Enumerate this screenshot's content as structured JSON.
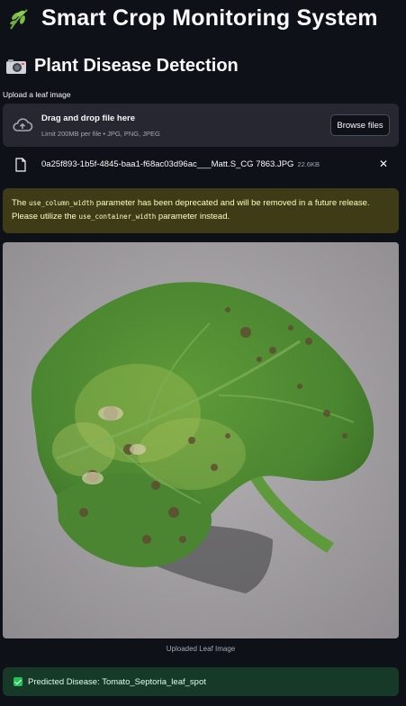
{
  "header": {
    "title": "Smart Crop Monitoring System",
    "title_icon": "seedling-icon"
  },
  "section": {
    "heading": "Plant Disease Detection",
    "heading_icon": "camera-icon"
  },
  "uploader": {
    "label": "Upload a leaf image",
    "drop_text": "Drag and drop file here",
    "limit_text": "Limit 200MB per file • JPG, PNG, JPEG",
    "browse_label": "Browse files"
  },
  "uploaded_file": {
    "name": "0a25f893-1b5f-4845-baa1-f68ac03d96ac___Matt.S_CG 7863.JPG",
    "size": "22.6KB"
  },
  "warning": {
    "prefix": "The",
    "code1": "use_column_width",
    "middle": "parameter has been deprecated and will be removed in a future release. Please utilize the",
    "code2": "use_container_width",
    "suffix": "parameter instead."
  },
  "image": {
    "caption": "Uploaded Leaf Image"
  },
  "result": {
    "text": "Predicted Disease: Tomato_Septoria_leaf_spot"
  },
  "colors": {
    "background": "#0e1117",
    "dropzone": "#262730",
    "warning_bg": "#3e3b16",
    "warning_text": "#ffffc2",
    "success_bg": "#173928",
    "success_check": "#21c354"
  }
}
